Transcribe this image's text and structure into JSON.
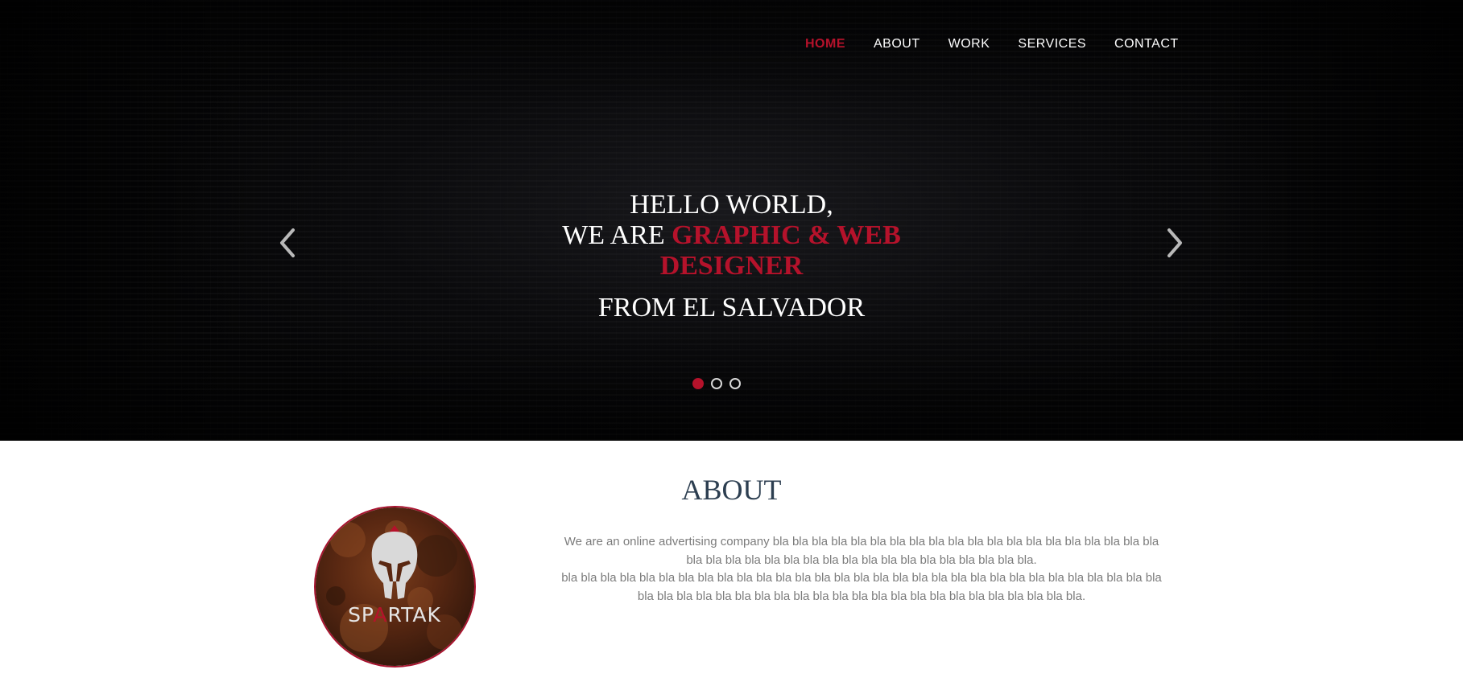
{
  "nav": {
    "items": [
      {
        "label": "HOME",
        "active": true
      },
      {
        "label": "ABOUT",
        "active": false
      },
      {
        "label": "WORK",
        "active": false
      },
      {
        "label": "SERVICES",
        "active": false
      },
      {
        "label": "CONTACT",
        "active": false
      }
    ]
  },
  "hero": {
    "line1": "HELLO WORLD,",
    "line2_prefix": "WE ARE ",
    "line2_accent": "GRAPHIC & WEB DESIGNER",
    "line3": "FROM EL SALVADOR",
    "prev_icon": "chevron-left-icon",
    "next_icon": "chevron-right-icon",
    "slides": {
      "count": 3,
      "active_index": 0
    }
  },
  "about": {
    "title": "ABOUT",
    "logo_text": "SPARTAK",
    "paragraph1": "We are an online advertising company bla bla bla bla bla bla bla bla bla bla bla bla bla bla bla bla bla bla bla bla bla bla bla bla bla bla bla bla bla bla bla bla bla bla bla bla bla bla.",
    "paragraph2": "bla bla bla bla bla bla bla bla bla bla bla bla bla bla bla bla bla bla bla bla bla bla bla bla bla bla bla bla bla bla bla bla bla bla bla bla bla bla bla bla bla bla bla bla bla bla bla bla bla bla bla bla bla bla."
  },
  "colors": {
    "accent": "#b5122b",
    "hero_background": "#050506",
    "about_title": "#2c3e50",
    "body_text": "#7c7c7c"
  }
}
